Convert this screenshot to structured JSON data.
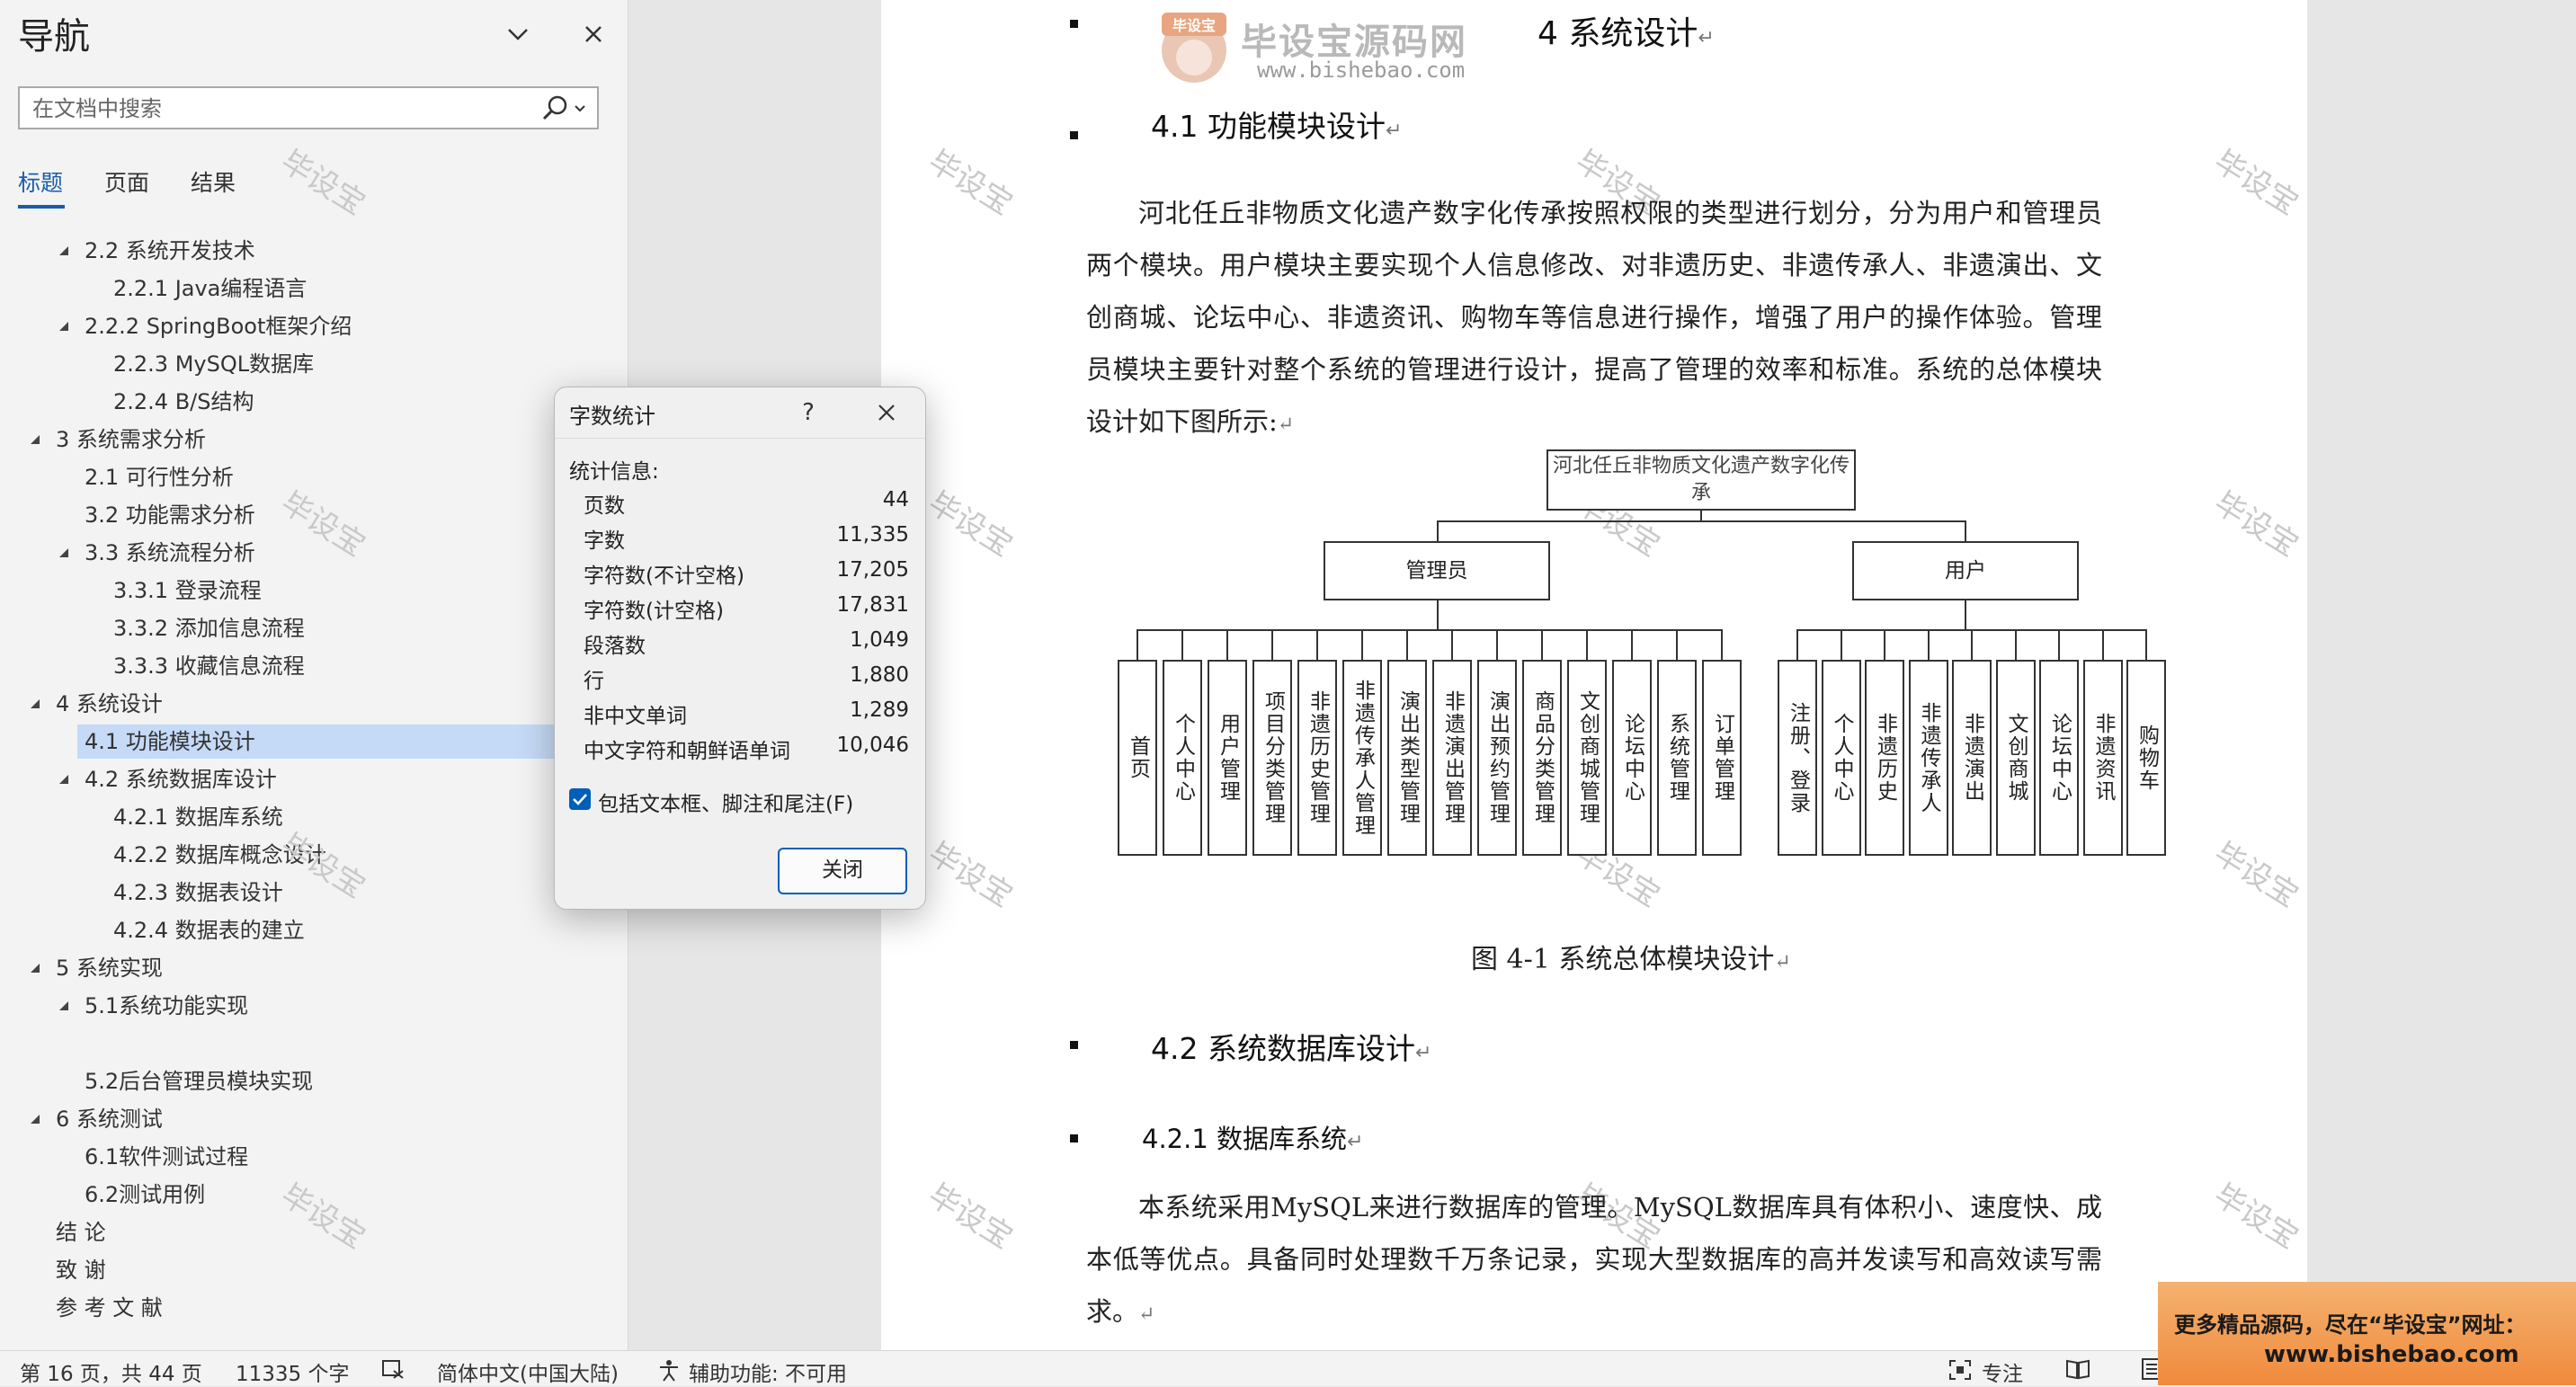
{
  "nav": {
    "title": "导航",
    "search_placeholder": "在文档中搜索",
    "tabs": [
      "标题",
      "页面",
      "结果"
    ],
    "items": [
      {
        "label": "2.2 系统开发技术",
        "level": 2,
        "arrow": true
      },
      {
        "label": "2.2.1 Java编程语言",
        "level": 3,
        "arrow": false
      },
      {
        "label": "2.2.2  SpringBoot框架介绍",
        "level": 2,
        "arrow": true
      },
      {
        "label": "2.2.3 MySQL数据库",
        "level": 3,
        "arrow": false
      },
      {
        "label": "2.2.4 B/S结构",
        "level": 3,
        "arrow": false
      },
      {
        "label": "3   系统需求分析",
        "level": 1,
        "arrow": true
      },
      {
        "label": "2.1 可行性分析",
        "level": 2,
        "arrow": false
      },
      {
        "label": "3.2 功能需求分析",
        "level": 2,
        "arrow": false
      },
      {
        "label": "3.3 系统流程分析",
        "level": 2,
        "arrow": true
      },
      {
        "label": "3.3.1 登录流程",
        "level": 3,
        "arrow": false
      },
      {
        "label": "3.3.2 添加信息流程",
        "level": 3,
        "arrow": false
      },
      {
        "label": "3.3.3 收藏信息流程",
        "level": 3,
        "arrow": false
      },
      {
        "label": "4   系统设计",
        "level": 1,
        "arrow": true
      },
      {
        "label": "4.1 功能模块设计",
        "level": 2,
        "arrow": false,
        "selected": true
      },
      {
        "label": "4.2 系统数据库设计",
        "level": 2,
        "arrow": true
      },
      {
        "label": "4.2.1 数据库系统",
        "level": 3,
        "arrow": false
      },
      {
        "label": "4.2.2 数据库概念设计",
        "level": 3,
        "arrow": false
      },
      {
        "label": "4.2.3 数据表设计",
        "level": 3,
        "arrow": false
      },
      {
        "label": "4.2.4 数据表的建立",
        "level": 3,
        "arrow": false
      },
      {
        "label": "5   系统实现",
        "level": 1,
        "arrow": true
      },
      {
        "label": "5.1系统功能实现",
        "level": 2,
        "arrow": true
      },
      {
        "label": "",
        "level": 2,
        "arrow": false
      },
      {
        "label": "5.2后台管理员模块实现",
        "level": 2,
        "arrow": false
      },
      {
        "label": "6   系统测试",
        "level": 1,
        "arrow": true
      },
      {
        "label": "6.1软件测试过程",
        "level": 2,
        "arrow": false
      },
      {
        "label": "6.2测试用例",
        "level": 2,
        "arrow": false
      },
      {
        "label": "结   论",
        "level": 1,
        "arrow": false
      },
      {
        "label": "致   谢",
        "level": 1,
        "arrow": false
      },
      {
        "label": "参 考 文 献",
        "level": 1,
        "arrow": false
      }
    ]
  },
  "document": {
    "h1": "4   系统设计",
    "h2_1": "4.1  功能模块设计",
    "para1": "河北任丘非物质文化遗产数字化传承按照权限的类型进行划分，分为用户和管理员两个模块。用户模块主要实现个人信息修改、对非遗历史、非遗传承人、非遗演出、文创商城、论坛中心、非遗资讯、购物车等信息进行操作，增强了用户的操作体验。管理员模块主要针对整个系统的管理进行设计，提高了管理的效率和标准。系统的总体模块设计如下图所示:",
    "diagram": {
      "root": "河北任丘非物质文化遗产数字化传承",
      "admin": "管理员",
      "user": "用户",
      "admin_children": [
        "首页",
        "个人中心",
        "用户管理",
        "项目分类管理",
        "非遗历史管理",
        "非遗传承人管理",
        "演出类型管理",
        "非遗演出管理",
        "演出预约管理",
        "商品分类管理",
        "文创商城管理",
        "论坛中心",
        "系统管理",
        "订单管理"
      ],
      "user_children": [
        "注册、登录",
        "个人中心",
        "非遗历史",
        "非遗传承人",
        "非遗演出",
        "文创商城",
        "论坛中心",
        "非遗资讯",
        "购物车"
      ]
    },
    "figure_caption": "图 4-1  系统总体模块设计",
    "h2_2": "4.2  系统数据库设计",
    "h3_1": "4.2.1  数据库系统",
    "para2": "本系统采用MySQL来进行数据库的管理。MySQL数据库具有体积小、速度快、成本低等优点。具备同时处理数千万条记录，实现大型数据库的高并发读写和高效读写需求。",
    "return_mark": "↵",
    "watermark": "毕设宝",
    "logo_title": "毕设宝源码网",
    "logo_url": "www.bishebao.com"
  },
  "dialog": {
    "title": "字数统计",
    "help": "?",
    "section": "统计信息:",
    "stats": [
      {
        "k": "页数",
        "v": "44"
      },
      {
        "k": "字数",
        "v": "11,335"
      },
      {
        "k": "字符数(不计空格)",
        "v": "17,205"
      },
      {
        "k": "字符数(计空格)",
        "v": "17,831"
      },
      {
        "k": "段落数",
        "v": "1,049"
      },
      {
        "k": "行",
        "v": "1,880"
      },
      {
        "k": "非中文单词",
        "v": "1,289"
      },
      {
        "k": "中文字符和朝鲜语单词",
        "v": "10,046"
      }
    ],
    "checkbox_label": "包括文本框、脚注和尾注(F)",
    "close_label": "关闭"
  },
  "status": {
    "page": "第 16 页，共 44 页",
    "words": "11335 个字",
    "language": "简体中文(中国大陆)",
    "accessibility": "辅助功能: 不可用",
    "focus": "专注"
  },
  "ad": {
    "line1": "更多精品源码，尽在“毕设宝”网址：",
    "line2": "www.bishebao.com"
  },
  "colors": {
    "accent": "#1a5cab",
    "selection": "#c5daf7",
    "dialog_button": "#005fb8",
    "ad": "#f08a3c"
  }
}
